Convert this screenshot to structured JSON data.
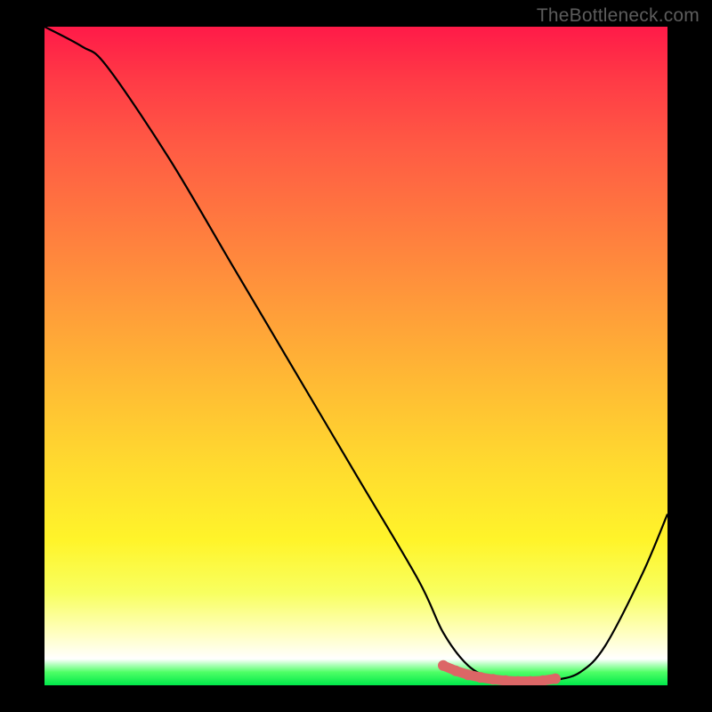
{
  "watermark": "TheBottleneck.com",
  "chart_data": {
    "type": "line",
    "title": "",
    "xlabel": "",
    "ylabel": "",
    "xlim": [
      0,
      100
    ],
    "ylim": [
      0,
      100
    ],
    "series": [
      {
        "name": "curve",
        "x": [
          0,
          6,
          10,
          20,
          30,
          40,
          50,
          60,
          64,
          68,
          72,
          76,
          78,
          82,
          86,
          90,
          96,
          100
        ],
        "values": [
          100,
          97,
          94,
          80,
          64,
          48,
          32,
          16,
          8,
          3,
          1,
          0.5,
          0.5,
          0.8,
          2,
          6,
          17,
          26
        ]
      }
    ],
    "highlight_points": {
      "name": "bottom_flat_markers",
      "x": [
        64,
        66,
        68,
        70,
        72,
        74,
        76,
        78,
        80,
        82
      ],
      "y": [
        3.0,
        2.2,
        1.6,
        1.2,
        0.9,
        0.7,
        0.6,
        0.6,
        0.7,
        1.0
      ],
      "color": "#dc6666"
    },
    "gradient_stops": [
      {
        "pos": 0.0,
        "color": "#ff1a48"
      },
      {
        "pos": 0.3,
        "color": "#ff7a3f"
      },
      {
        "pos": 0.66,
        "color": "#ffd92f"
      },
      {
        "pos": 0.92,
        "color": "#ffffbf"
      },
      {
        "pos": 1.0,
        "color": "#00e84a"
      }
    ]
  }
}
